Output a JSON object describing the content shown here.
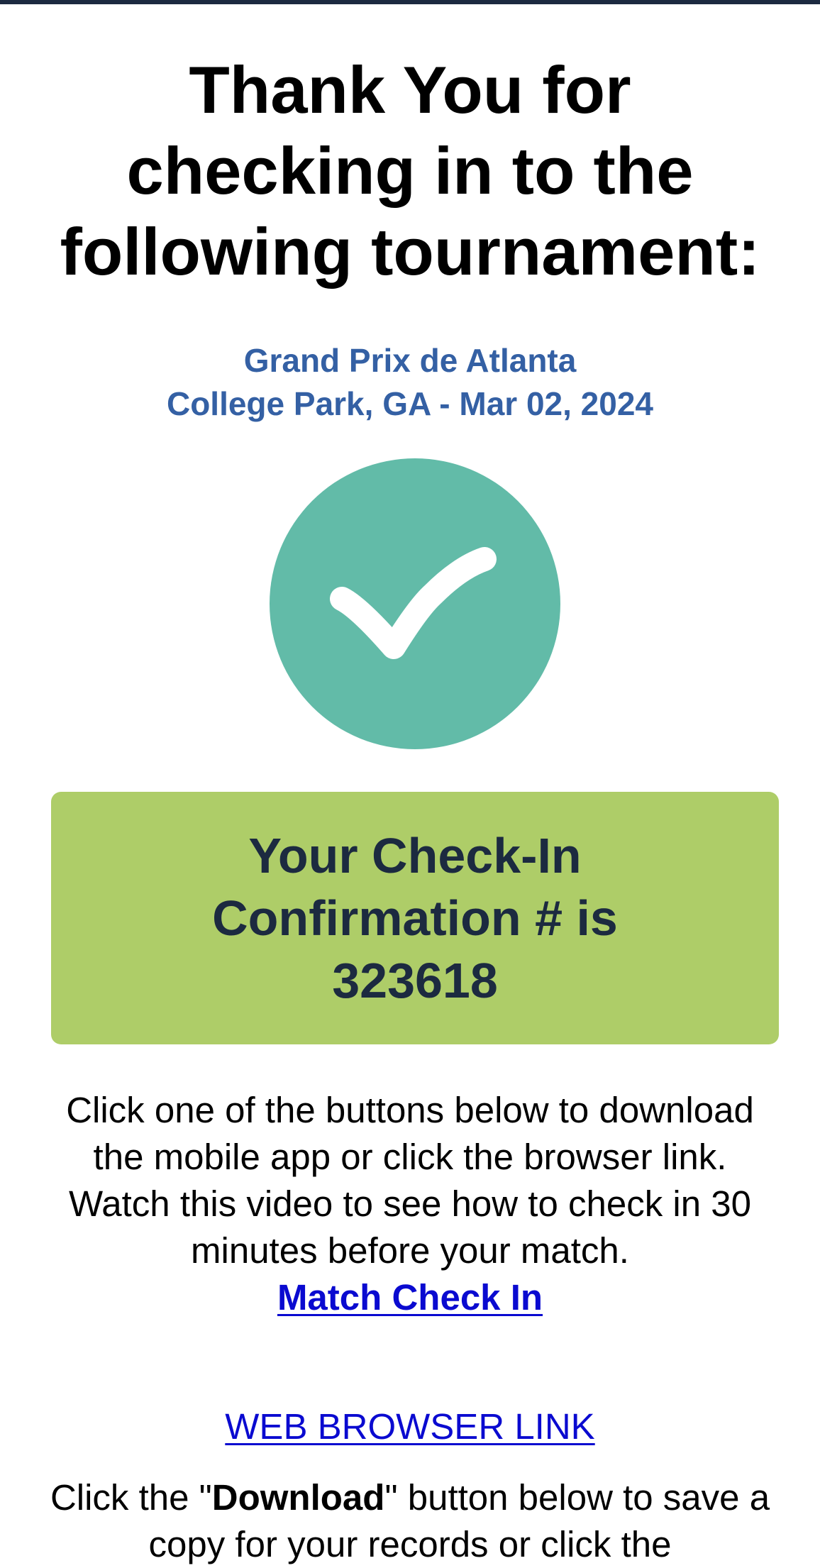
{
  "header": {
    "title": "Thank You for checking in to the following tournament:"
  },
  "tournament": {
    "name": "Grand Prix de Atlanta",
    "location_date": "College Park, GA - Mar 02, 2024"
  },
  "status_icon": {
    "icon": "check-circle-icon",
    "color": "#62bba8"
  },
  "confirmation": {
    "text": "Your Check-In Confirmation # is 323618",
    "background": "#aecd68"
  },
  "instructions": {
    "text": "Click one of the buttons below to download the mobile app or click the browser link. Watch this video to see how to check in 30 minutes before your match.",
    "video_link_label": "Match Check In"
  },
  "web_browser_link": {
    "label": "WEB BROWSER LINK"
  },
  "download": {
    "prefix": "Click the \"",
    "bold": "Download",
    "suffix": "\" button below to save a copy for your records or click the"
  },
  "colors": {
    "accent_blue": "#3460a4",
    "link": "#0a0ad0",
    "dark_navy": "#1c2a40"
  }
}
